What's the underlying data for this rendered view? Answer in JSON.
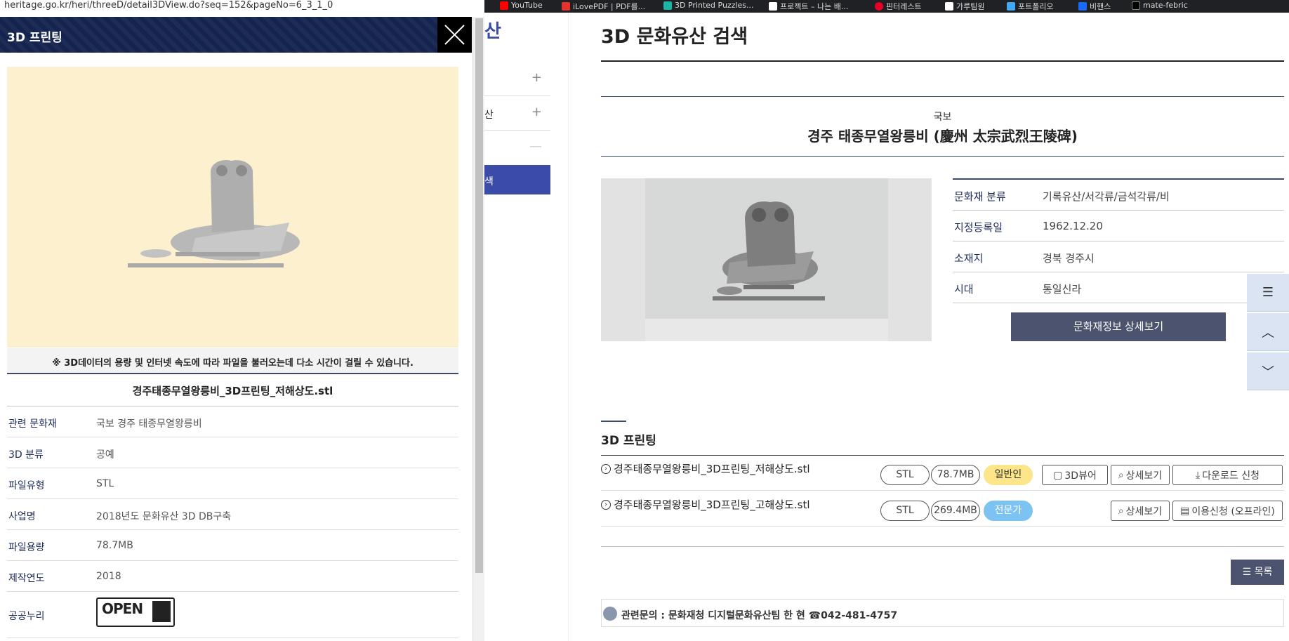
{
  "browser": {
    "bookmarks": [
      "YouTube",
      "iLovePDF | PDF를...",
      "3D Printed Puzzles...",
      "프로젝트 – 나는 배...",
      "핀터레스트",
      "가루팀원",
      "포트폴리오",
      "비핸스",
      "mate-febric"
    ],
    "bookmark_colors": [
      "#ff0000",
      "#e5322d",
      "#19b5a5",
      "#ffffff",
      "#e60023",
      "#ffffff",
      "#3ea9f5",
      "#1769ff",
      "#000000"
    ]
  },
  "popup": {
    "url": "heritage.go.kr/heri/threeD/detail3DView.do?seq=152&pageNo=6_3_1_0",
    "title": "3D 프린팅",
    "notice": "※ 3D데이터의 용량 및 인터넷 속도에 따라 파일을 불러오는데 다소 시간이 걸릴 수 있습니다.",
    "file_title": "경주태종무열왕릉비_3D프린팅_저해상도.stl",
    "info": [
      {
        "k": "관련 문화재",
        "v": "국보 경주 태종무열왕릉비"
      },
      {
        "k": "3D 분류",
        "v": "공예"
      },
      {
        "k": "파일유형",
        "v": "STL"
      },
      {
        "k": "사업명",
        "v": "2018년도 문화유산 3D DB구축"
      },
      {
        "k": "파일용량",
        "v": "78.7MB"
      },
      {
        "k": "제작연도",
        "v": "2018"
      }
    ],
    "license_label": "공공누리",
    "license_open": "OPEN"
  },
  "main": {
    "logo_fragment": "산",
    "nav": [
      {
        "label": "",
        "sym": "+"
      },
      {
        "label": "산",
        "sym": "+"
      },
      {
        "label": "",
        "sym": "—"
      }
    ],
    "nav_active": "색",
    "page_title": "3D 문화유산 검색",
    "category": "국보",
    "heritage_name": "경주 태종무열왕릉비 (慶州 太宗武烈王陵碑)",
    "details": [
      {
        "k": "문화재 분류",
        "v": "기록유산/서각류/금석각류/비"
      },
      {
        "k": "지정등록일",
        "v": "1962.12.20"
      },
      {
        "k": "소재지",
        "v": "경북 경주시"
      },
      {
        "k": "시대",
        "v": "통일신라"
      }
    ],
    "detail_button": "문화재정보 상세보기",
    "section_title": "3D 프린팅",
    "files": [
      {
        "name": "경주태종무열왕릉비_3D프린팅_저해상도.stl",
        "type": "STL",
        "size": "78.7MB",
        "audience": "일반인",
        "actions": [
          "3D뷰어",
          "상세보기",
          "다운로드 신청"
        ]
      },
      {
        "name": "경주태종무열왕릉비_3D프린팅_고해상도.stl",
        "type": "STL",
        "size": "269.4MB",
        "audience": "전문가",
        "actions": [
          "상세보기",
          "이용신청 (오프라인)"
        ]
      }
    ],
    "list_button": "☰ 목록",
    "contact": "관련문의 : 문화재청 디지털문화유산팀 한 현 ☎042-481-4757"
  }
}
